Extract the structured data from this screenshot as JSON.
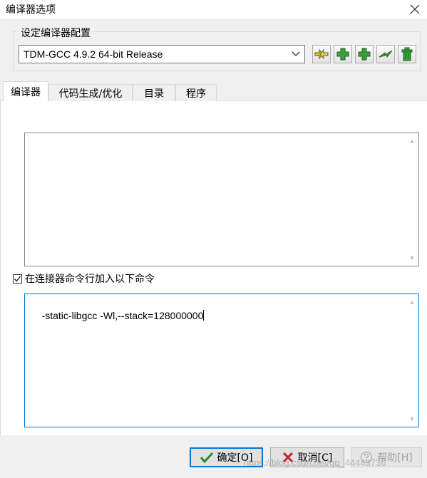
{
  "window": {
    "title": "编译器选项",
    "close_glyph": "✕"
  },
  "compiler_config": {
    "group_title": "设定编译器配置",
    "selected": "TDM-GCC 4.9.2 64-bit Release",
    "toolbar_icons": [
      "rename-icon",
      "add-icon",
      "add-icon",
      "copy-icon",
      "delete-icon"
    ]
  },
  "tabs": [
    {
      "label": "编译器",
      "active": true
    },
    {
      "label": "代码生成/优化",
      "active": false
    },
    {
      "label": "目录",
      "active": false
    },
    {
      "label": "程序",
      "active": false
    }
  ],
  "compiler_panel": {
    "compiler_commands_value": "",
    "linker_checkbox_label": "在连接器命令行加入以下命令",
    "linker_checkbox_checked": true,
    "linker_commands_value": "-static-libgcc -Wl,--stack=128000000"
  },
  "buttons": {
    "ok": "确定[O]",
    "cancel": "取消[C]",
    "help": "帮助[H]"
  },
  "watermark": "https://blog.csdn.net/qq_44443736",
  "colors": {
    "accent": "#0078d7",
    "green_icon": "#3aa13a",
    "cancel_x": "#c4262e"
  }
}
